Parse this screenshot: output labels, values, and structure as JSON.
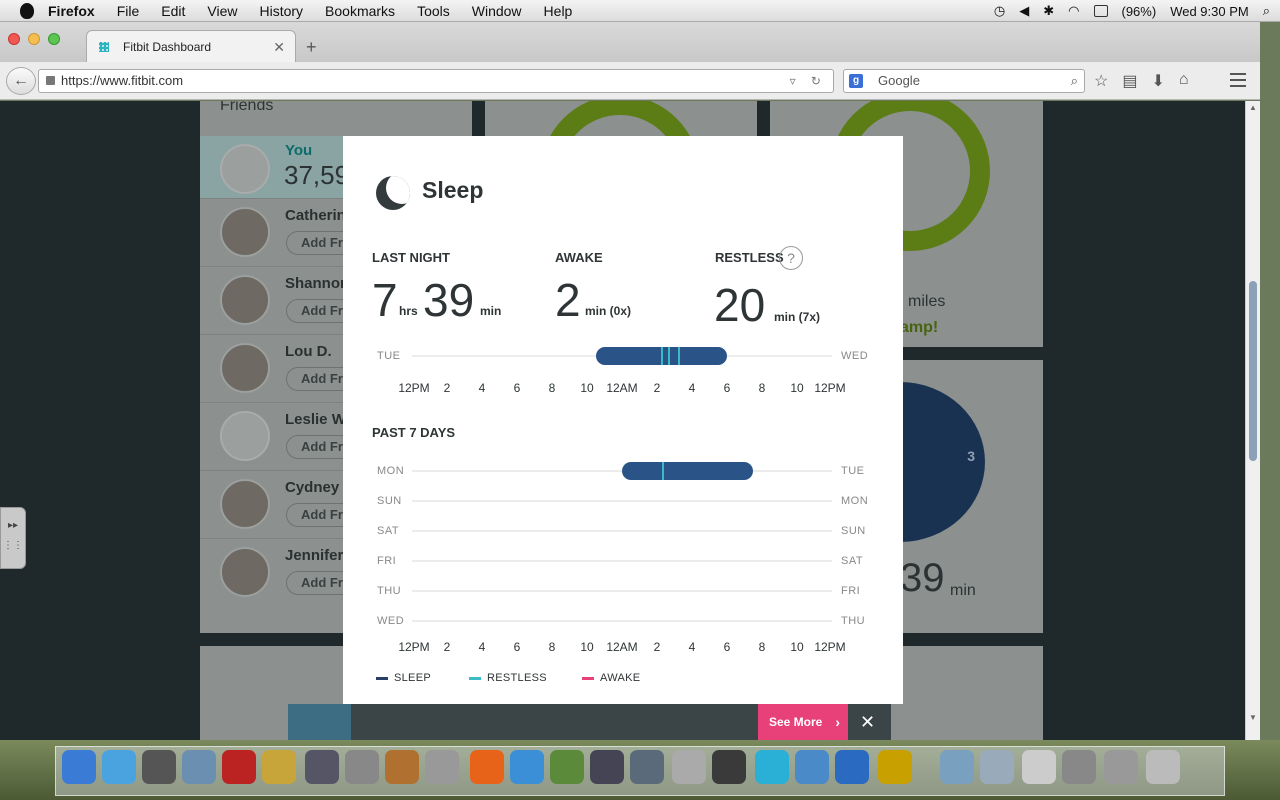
{
  "menubar": {
    "app": "Firefox",
    "items": [
      "File",
      "Edit",
      "View",
      "History",
      "Bookmarks",
      "Tools",
      "Window",
      "Help"
    ],
    "battery": "(96%)",
    "clock": "Wed 9:30 PM"
  },
  "browser": {
    "tab_title": "Fitbit Dashboard",
    "url": "https://www.fitbit.com",
    "search_placeholder": "Google"
  },
  "background": {
    "friends_title": "Friends",
    "you_label": "You",
    "you_steps": "37,59",
    "add_label": "Add Fri",
    "friends": [
      {
        "name": "Catherin"
      },
      {
        "name": "Shannon"
      },
      {
        "name": "Lou D."
      },
      {
        "name": "Leslie W"
      },
      {
        "name": "Cydney"
      },
      {
        "name": "Jennifer"
      }
    ],
    "miles_label": "miles",
    "champ_label": "amp!",
    "clock_three": "3",
    "minutes_value": "39",
    "minutes_unit": "min"
  },
  "sleep_modal": {
    "title": "Sleep",
    "last_night": {
      "label": "LAST NIGHT",
      "hours": "7",
      "hours_unit": "hrs",
      "minutes": "39",
      "minutes_unit": "min"
    },
    "awake": {
      "label": "AWAKE",
      "value": "2",
      "unit": "min (0x)"
    },
    "restless": {
      "label": "RESTLESS",
      "value": "20",
      "unit": "min (7x)",
      "help": "?"
    },
    "last_night_chart": {
      "start_day": "TUE",
      "end_day": "WED",
      "hour_labels": [
        "12PM",
        "2",
        "4",
        "6",
        "8",
        "10",
        "12AM",
        "2",
        "4",
        "6",
        "8",
        "10",
        "12PM"
      ]
    },
    "past7": {
      "label": "PAST 7 DAYS",
      "rows": [
        {
          "left": "MON",
          "right": "TUE"
        },
        {
          "left": "SUN",
          "right": "MON"
        },
        {
          "left": "SAT",
          "right": "SUN"
        },
        {
          "left": "FRI",
          "right": "SAT"
        },
        {
          "left": "THU",
          "right": "FRI"
        },
        {
          "left": "WED",
          "right": "THU"
        }
      ],
      "hour_labels": [
        "12PM",
        "2",
        "4",
        "6",
        "8",
        "10",
        "12AM",
        "2",
        "4",
        "6",
        "8",
        "10",
        "12PM"
      ]
    },
    "legend": [
      {
        "label": "SLEEP",
        "color": "#2a3f66"
      },
      {
        "label": "RESTLESS",
        "color": "#3bbcc4"
      },
      {
        "label": "AWAKE",
        "color": "#e8417a"
      }
    ],
    "see_more": "See More",
    "close": "✕"
  },
  "chart_data": {
    "type": "bar",
    "title": "",
    "last_night": {
      "start_hour": 22.5,
      "end_hour": 30.0,
      "restless_at_hours": [
        26.2,
        26.6,
        27.2
      ]
    },
    "past_7_days": [
      {
        "day": "MON",
        "start_hour": 24.0,
        "end_hour": 31.5,
        "restless_at_hours": [
          26.3
        ]
      },
      {
        "day": "SUN",
        "start_hour": null,
        "end_hour": null
      },
      {
        "day": "SAT",
        "start_hour": null,
        "end_hour": null
      },
      {
        "day": "FRI",
        "start_hour": null,
        "end_hour": null
      },
      {
        "day": "THU",
        "start_hour": null,
        "end_hour": null
      },
      {
        "day": "WED",
        "start_hour": null,
        "end_hour": null
      }
    ],
    "xlim_hours": [
      12,
      36
    ],
    "colors": {
      "sleep": "#2a5488",
      "restless": "#3bbcc4",
      "awake": "#e8417a"
    }
  }
}
